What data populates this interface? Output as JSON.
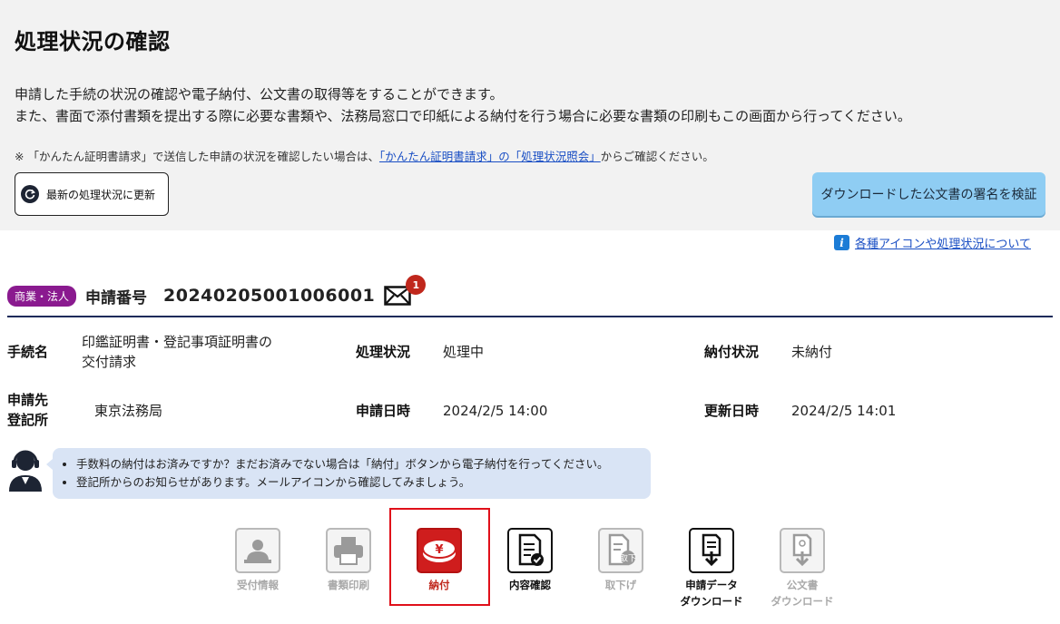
{
  "page_title": "処理状況の確認",
  "description": {
    "line1": "申請した手続の状況の確認や電子納付、公文書の取得等をすることができます。",
    "line2": "また、書面で添付書類を提出する際に必要な書類や、法務局窓口で印紙による納付を行う場合に必要な書類の印刷もこの画面から行ってください。"
  },
  "note": {
    "prefix": "※ 「かんたん証明書請求」で送信した申請の状況を確認したい場合は、",
    "link": "「かんたん証明書請求」の「処理状況照会」",
    "suffix": "からご確認ください。"
  },
  "buttons": {
    "refresh": "最新の処理状況に更新",
    "verify": "ダウンロードした公文書の署名を検証"
  },
  "icon_help_link": "各種アイコンや処理状況について",
  "application": {
    "badge": "商業・法人",
    "number_label": "申請番号",
    "number": "20240205001006001",
    "mail_count": "1"
  },
  "details": {
    "procedure_label": "手続名",
    "procedure_line1": "印鑑証明書・登記事項証明書の",
    "procedure_line2": "交付請求",
    "status_label": "処理状況",
    "status": "処理中",
    "payment_label": "納付状況",
    "payment": "未納付",
    "office_label_line1": "申請先",
    "office_label_line2": "登記所",
    "office": "東京法務局",
    "submitted_label": "申請日時",
    "submitted": "2024/2/5 14:00",
    "updated_label": "更新日時",
    "updated": "2024/2/5 14:01"
  },
  "notices": [
    "手数料の納付はお済みですか？まだお済みでない場合は「納付」ボタンから電子納付を行ってください。",
    "登記所からのお知らせがあります。メールアイコンから確認してみましょう。"
  ],
  "actions": {
    "receipt": "受付情報",
    "print": "書類印刷",
    "payment": "納付",
    "content": "内容確認",
    "withdraw": "取下げ",
    "withdraw_icon_text": "取下",
    "download_data_line1": "申請データ",
    "download_data_line2": "ダウンロード",
    "download_doc_line1": "公文書",
    "download_doc_line2": "ダウンロード",
    "yen_symbol": "¥"
  },
  "colors": {
    "badge": "#8a1a8f",
    "verify_button": "#8fcdf3",
    "payment_button": "#cf1d1d",
    "highlight_border": "#e0101a",
    "header_rule": "#1a2a5a"
  }
}
